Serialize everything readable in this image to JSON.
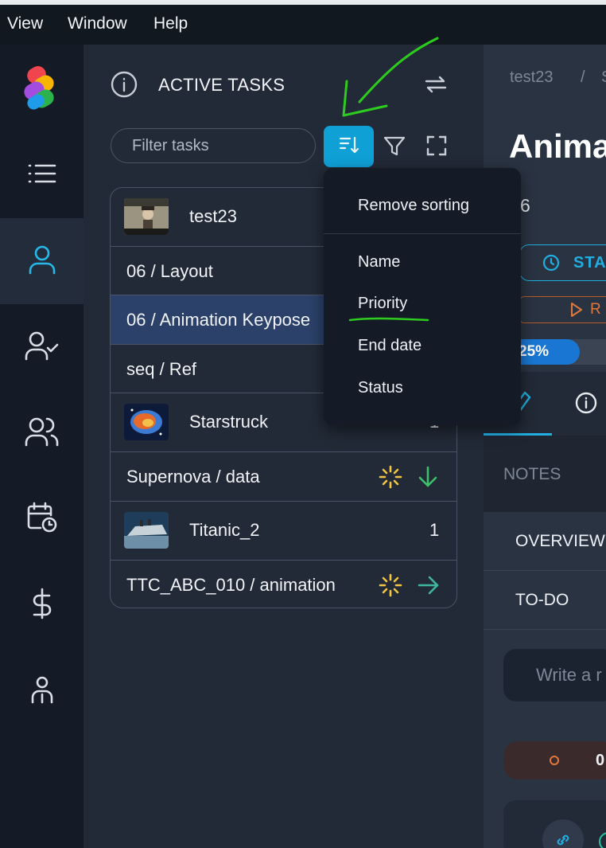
{
  "menubar": {
    "items": [
      "View",
      "Window",
      "Help"
    ]
  },
  "nav": {
    "items": [
      {
        "icon": "list-icon"
      },
      {
        "icon": "user-icon"
      },
      {
        "icon": "user-check-icon"
      },
      {
        "icon": "users-icon"
      },
      {
        "icon": "calendar-clock-icon"
      },
      {
        "icon": "dollar-icon"
      },
      {
        "icon": "people-group-icon"
      }
    ]
  },
  "panel": {
    "title": "ACTIVE TASKS",
    "filter_placeholder": "Filter tasks"
  },
  "tasks": [
    {
      "label": "test23",
      "thumb": "video-thumbnail"
    },
    {
      "label": "06 / Layout"
    },
    {
      "label": "06 / Animation Keypose"
    },
    {
      "label": "seq / Ref"
    },
    {
      "label": "Starstruck",
      "count": "1",
      "thumb": "nebula-thumbnail"
    },
    {
      "label": "Supernova / data",
      "status_icon": "spinner-icon",
      "priority_icon": "arrow-down-icon"
    },
    {
      "label": "Titanic_2",
      "count": "1",
      "thumb": "ship-thumbnail"
    },
    {
      "label": "TTC_ABC_010 / animation",
      "status_icon": "spinner-icon",
      "priority_icon": "arrow-right-icon"
    }
  ],
  "sort_menu": {
    "remove": "Remove sorting",
    "options": [
      "Name",
      "Priority",
      "End date",
      "Status"
    ]
  },
  "right": {
    "breadcrumb_1": "test23",
    "breadcrumb_sep": "/",
    "breadcrumb_2": "S",
    "title": "Anima",
    "sub": "6",
    "status_btn": "STA",
    "review_btn": "R",
    "progress": "25%",
    "progress_value": 0.25,
    "notes": "NOTES",
    "overview": "OVERVIEW",
    "todo": "TO-DO",
    "write_placeholder": "Write a r",
    "badge_value": "0"
  },
  "colors": {
    "accent": "#0fa0d6",
    "progress": "#1976d2",
    "spinner": "#f4c542",
    "arrow_down": "#3fbf6a",
    "arrow_right": "#3fb7a0",
    "review": "#e0783a",
    "annotation": "#2ecc1f"
  }
}
